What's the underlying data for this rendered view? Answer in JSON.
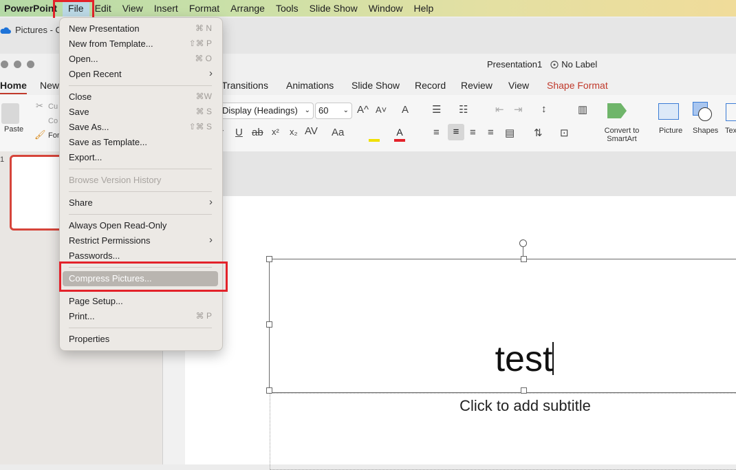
{
  "menubar": {
    "app": "PowerPoint",
    "items": [
      "File",
      "Edit",
      "View",
      "Insert",
      "Format",
      "Arrange",
      "Tools",
      "Slide Show",
      "Window",
      "Help"
    ]
  },
  "background_window": {
    "tab_label": "Pictures - C"
  },
  "document": {
    "title": "Presentation1",
    "label": "No Label"
  },
  "ribbon_tabs": [
    "Home",
    "New",
    "Transitions",
    "Animations",
    "Slide Show",
    "Record",
    "Review",
    "View",
    "Shape Format"
  ],
  "ribbon": {
    "paste": "Paste",
    "cut": "Cu",
    "copy": "Co",
    "format": "For",
    "font_name": "Display (Headings)",
    "font_size": "60",
    "convert_smartart": "Convert to SmartArt",
    "picture": "Picture",
    "shapes": "Shapes",
    "text": "Tex",
    "bold_partial": "r",
    "underline": "U",
    "strike": "ab",
    "superscript": "x²",
    "subscript": "x₂",
    "char_spacing": "AV",
    "change_case": "Aa"
  },
  "slide_number": "1",
  "slide": {
    "title_text": "test",
    "subtitle_placeholder": "Click to add subtitle"
  },
  "file_menu": {
    "new_presentation": {
      "label": "New Presentation",
      "shortcut": "⌘ N"
    },
    "new_from_template": {
      "label": "New from Template...",
      "shortcut": "⇧⌘ P"
    },
    "open": {
      "label": "Open...",
      "shortcut": "⌘ O"
    },
    "open_recent": {
      "label": "Open Recent"
    },
    "close": {
      "label": "Close",
      "shortcut": "⌘W"
    },
    "save": {
      "label": "Save",
      "shortcut": "⌘ S"
    },
    "save_as": {
      "label": "Save As...",
      "shortcut": "⇧⌘ S"
    },
    "save_as_template": {
      "label": "Save as Template..."
    },
    "export": {
      "label": "Export..."
    },
    "browse_version_history": {
      "label": "Browse Version History"
    },
    "share": {
      "label": "Share"
    },
    "always_open_read_only": {
      "label": "Always Open Read-Only"
    },
    "restrict_permissions": {
      "label": "Restrict Permissions"
    },
    "passwords": {
      "label": "Passwords..."
    },
    "compress_pictures": {
      "label": "Compress Pictures..."
    },
    "page_setup": {
      "label": "Page Setup..."
    },
    "print": {
      "label": "Print...",
      "shortcut": "⌘ P"
    },
    "properties": {
      "label": "Properties"
    }
  },
  "colors": {
    "accent_red": "#e3222a",
    "shape_format_tab": "#c0392b",
    "menu_highlight": "#b9b5b0"
  }
}
